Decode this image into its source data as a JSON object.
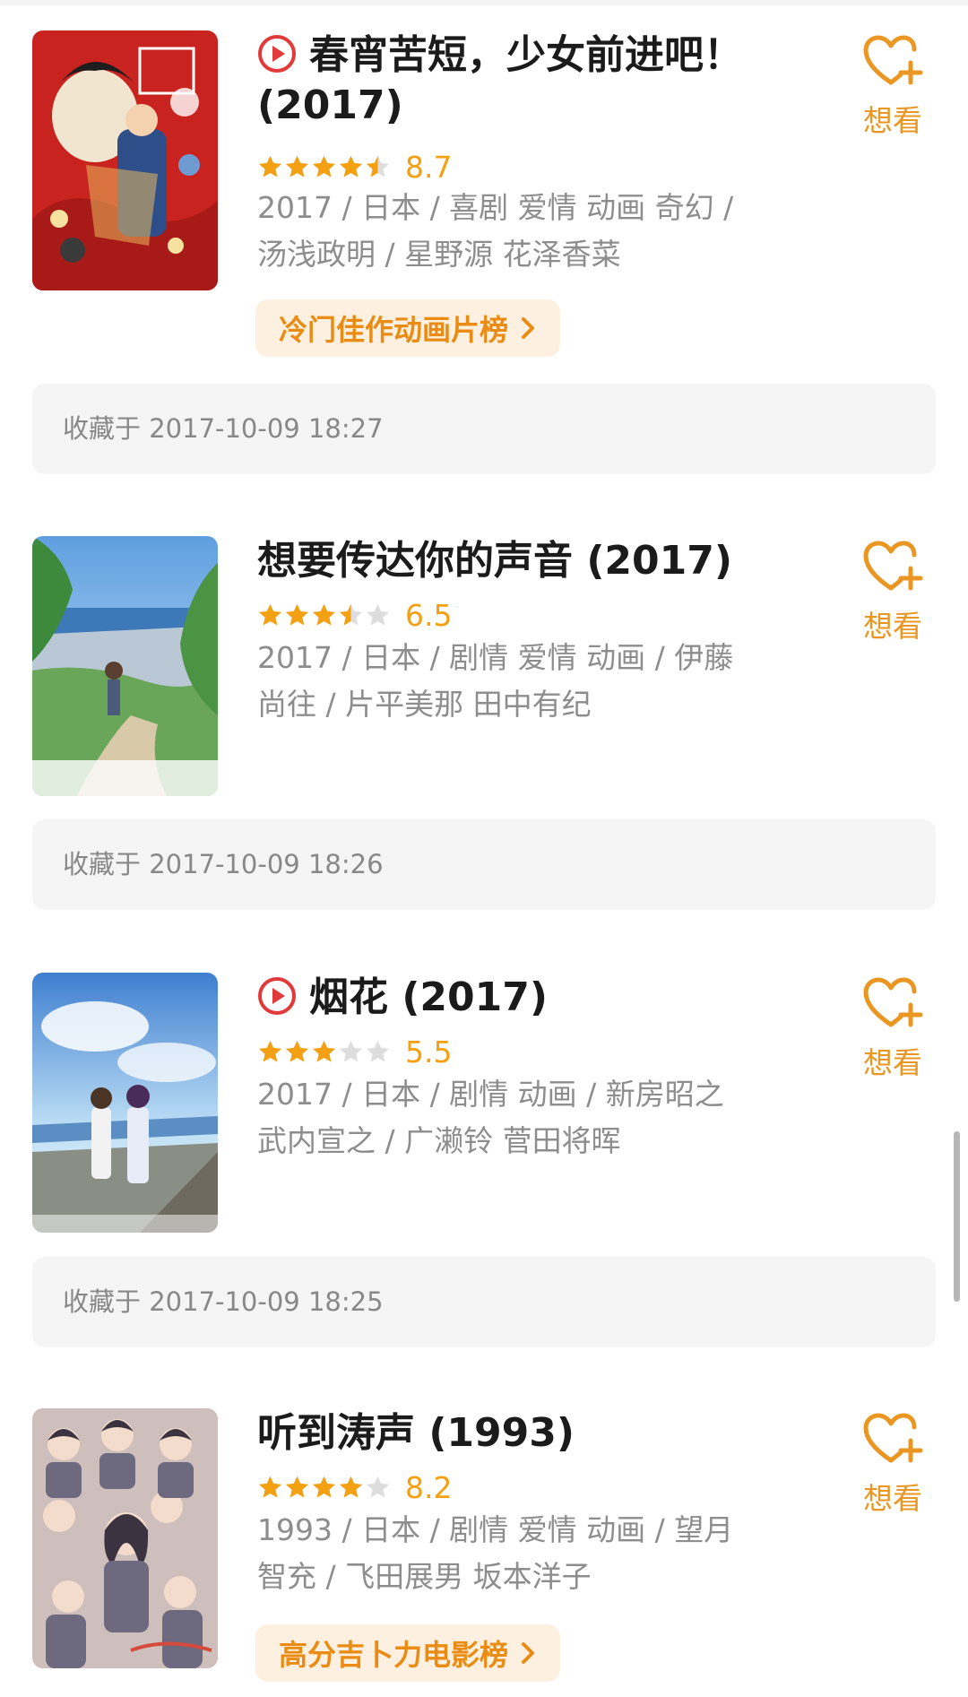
{
  "colors": {
    "star": "#f3a012",
    "star_empty": "#dddddd",
    "accent": "#ea9622",
    "play": "#e23a3a"
  },
  "wish_label": "想看",
  "items": [
    {
      "title_line1": "春宵苦短，少女前进吧！",
      "title_line2": "(2017)",
      "playable": true,
      "rating": 8.7,
      "score_text": "8.7",
      "meta_line1": "2017 / 日本 / 喜剧 爱情 动画 奇幻 /",
      "meta_line2": "汤浅政明 / 星野源 花泽香菜",
      "rank_label": "冷门佳作动画片榜",
      "collected": "收藏于 2017-10-09 18:27"
    },
    {
      "title": "想要传达你的声音 (2017)",
      "playable": false,
      "rating": 6.5,
      "score_text": "6.5",
      "meta_line1": "2017 / 日本 / 剧情 爱情 动画 / 伊藤",
      "meta_line2": "尚往 / 片平美那 田中有纪",
      "collected": "收藏于 2017-10-09 18:26"
    },
    {
      "title": "烟花 (2017)",
      "playable": true,
      "rating": 5.5,
      "score_text": "5.5",
      "meta_line1": "2017 / 日本 / 剧情 动画 / 新房昭之",
      "meta_line2": "武内宣之 / 广濑铃 菅田将晖",
      "collected": "收藏于 2017-10-09 18:25"
    },
    {
      "title": "听到涛声 (1993)",
      "playable": false,
      "rating": 8.2,
      "score_text": "8.2",
      "meta_line1": "1993 / 日本 / 剧情 爱情 动画 / 望月",
      "meta_line2": "智充 / 飞田展男 坂本洋子",
      "rank_label": "高分吉卜力电影榜"
    }
  ]
}
